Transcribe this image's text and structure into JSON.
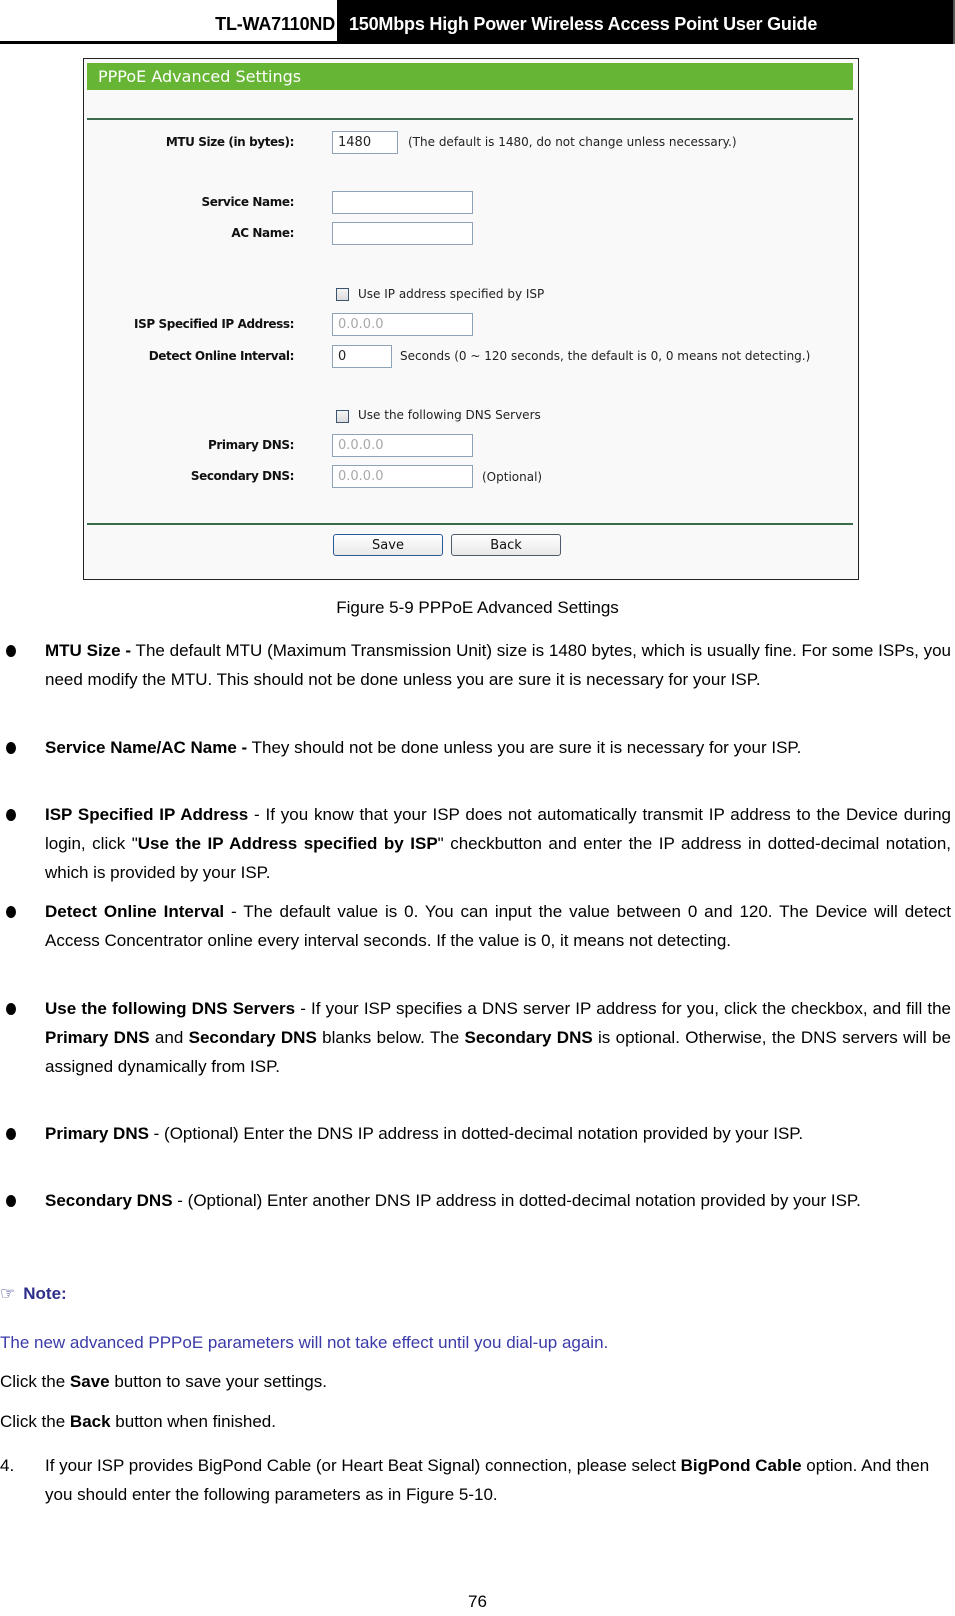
{
  "header": {
    "model": "TL-WA7110ND",
    "title": "150Mbps High Power Wireless Access Point User Guide"
  },
  "figure": {
    "panel_title": "PPPoE Advanced Settings",
    "mtu_label": "MTU Size (in bytes):",
    "mtu_value": "1480",
    "mtu_hint": "(The default is 1480, do not change unless necessary.)",
    "service_name_label": "Service Name:",
    "service_name_value": "",
    "ac_name_label": "AC Name:",
    "ac_name_value": "",
    "use_ip_checkbox_label": "Use IP address specified by ISP",
    "use_ip_checked": false,
    "isp_ip_label": "ISP Specified IP Address:",
    "isp_ip_value": "0.0.0.0",
    "detect_label": "Detect Online Interval:",
    "detect_value": "0",
    "detect_hint": "Seconds (0 ~ 120 seconds, the default is 0, 0 means not detecting.)",
    "use_dns_checkbox_label": "Use the following DNS Servers",
    "use_dns_checked": false,
    "primary_dns_label": "Primary DNS:",
    "primary_dns_value": "0.0.0.0",
    "secondary_dns_label": "Secondary DNS:",
    "secondary_dns_value": "0.0.0.0",
    "secondary_dns_hint": "(Optional)",
    "save_label": "Save",
    "back_label": "Back",
    "caption": "Figure 5-9 PPPoE Advanced Settings"
  },
  "bullets": [
    {
      "term": "MTU Size -",
      "text": " The default MTU (Maximum Transmission Unit) size is 1480 bytes, which  is usually fine. For some ISPs, you need modify the MTU. This should not be done unless you are sure it is necessary for your ISP."
    },
    {
      "term": "Service Name/AC Name -",
      "text": " They should not be done unless you are sure it is necessary for your ISP."
    },
    {
      "term": "ISP Specified IP Address",
      "text_a": " - If you know that your ISP does not automatically transmit IP address to the Device during login, click \"",
      "bold_a": "Use the IP Address specified by ISP",
      "text_b": "\" checkbutton and enter the IP address in dotted-decimal notation, which is provided by your ISP."
    },
    {
      "term": "Detect Online Interval",
      "text": " - The default value is 0. You can input the value between 0 and 120. The Device will detect Access Concentrator online every interval seconds. If the value is 0, it means not detecting."
    },
    {
      "term": "Use the following DNS Servers",
      "text_a": " - If your ISP specifies a DNS server IP address for you, click the checkbox, and fill the ",
      "bold_a": "Primary DNS",
      "text_b": " and ",
      "bold_b": "Secondary DNS",
      "text_c": " blanks below.  The ",
      "bold_c": "Secondary DNS",
      "text_d": " is optional. Otherwise, the DNS servers will be assigned dynamically from ISP."
    },
    {
      "term": "Primary DNS",
      "text": " - (Optional) Enter the DNS IP address in dotted-decimal notation provided by your ISP."
    },
    {
      "term": "Secondary DNS",
      "text": " - (Optional) Enter another DNS IP address in dotted-decimal notation provided by your ISP."
    }
  ],
  "note": {
    "icon": "pointing-hand-icon",
    "heading": "Note:",
    "text": "The new advanced PPPoE parameters will not take effect until you dial-up again."
  },
  "instructions": {
    "save_pre": "Click the ",
    "save_bold": "Save",
    "save_post": " button to save your settings.",
    "back_pre": "Click the ",
    "back_bold": "Back",
    "back_post": " button when finished."
  },
  "step4": {
    "number": "4.",
    "text_a": "If your ISP provides BigPond Cable (or Heart Beat Signal) connection, please select ",
    "bold_a": "BigPond Cable",
    "text_b": " option. And then you should enter the following parameters as in Figure 5-10."
  },
  "page_number": "76"
}
